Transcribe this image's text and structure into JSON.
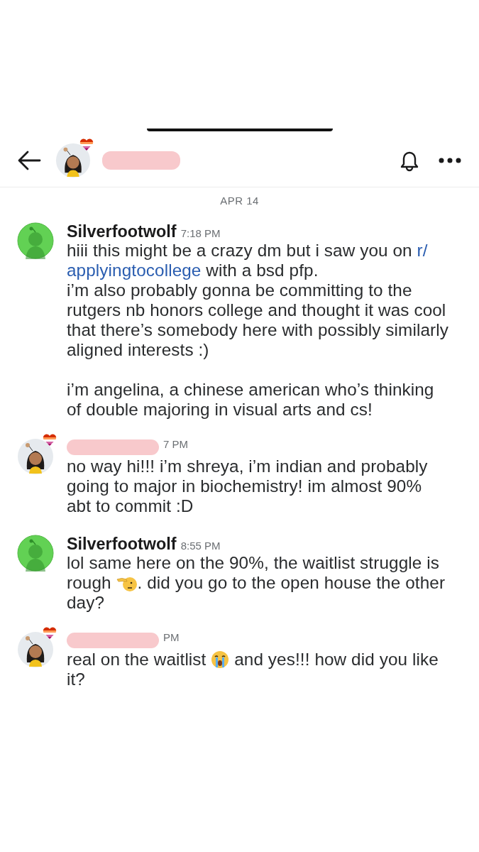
{
  "header": {
    "name_redacted": true,
    "notifications": true,
    "more": true
  },
  "date_divider": "APR 14",
  "messages": [
    {
      "avatar": {
        "kind": "snoo"
      },
      "author": "Silverfootwolf",
      "author_redacted": false,
      "time": "7:18 PM",
      "paragraphs": [
        [
          [
            {
              "kind": "text",
              "text": "hiii this might be a crazy dm but i saw you on "
            },
            {
              "kind": "link",
              "text": "r/"
            },
            {
              "kind": "link",
              "text": "applyingtocollege"
            },
            {
              "kind": "text",
              "text": " with a bsd pfp."
            }
          ],
          [
            {
              "kind": "text",
              "text": "i’m also probably gonna be committing to the rutgers nb honors college and thought it was cool that there’s somebody here with possibly similarly aligned interests :)"
            }
          ]
        ],
        [
          [
            {
              "kind": "text",
              "text": "i’m angelina, a chinese american who’s thinking of double majoring in visual arts and cs!"
            }
          ]
        ]
      ]
    },
    {
      "avatar": {
        "kind": "character"
      },
      "author_redacted": true,
      "time": "7 PM",
      "paragraphs": [
        [
          [
            {
              "kind": "text",
              "text": "no way hi!!! i’m shreya, i’m indian and probably going to major in biochemistry! im almost 90% abt to commit :D"
            }
          ]
        ]
      ]
    },
    {
      "avatar": {
        "kind": "snoo"
      },
      "author": "Silverfootwolf",
      "author_redacted": false,
      "time": "8:55 PM",
      "paragraphs": [
        [
          [
            {
              "kind": "text",
              "text": "lol same here on the 90%, the waitlist struggle is rough "
            },
            {
              "kind": "emoji",
              "emoji": {
                "kind": "salute"
              }
            },
            {
              "kind": "text",
              "text": ". did you go to the open house the other day?"
            }
          ]
        ]
      ]
    },
    {
      "avatar": {
        "kind": "character"
      },
      "author_redacted": true,
      "time": "PM",
      "paragraphs": [
        [
          [
            {
              "kind": "text",
              "text": "real on the waitlist "
            },
            {
              "kind": "emoji",
              "emoji": {
                "kind": "crying"
              }
            },
            {
              "kind": "text",
              "text": " and yes!!! how did you like it?"
            }
          ]
        ]
      ]
    }
  ]
}
